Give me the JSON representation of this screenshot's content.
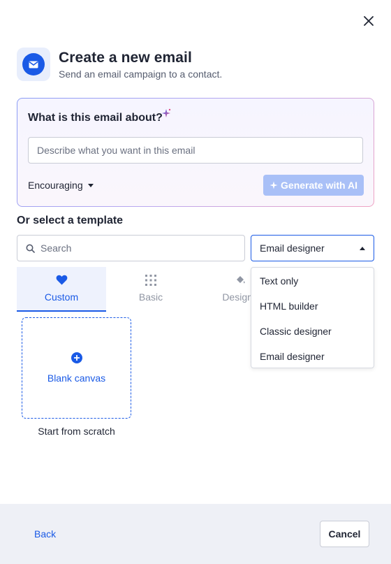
{
  "dialog": {
    "title": "Create a new email",
    "subtitle": "Send an email campaign to a contact.",
    "icons": {
      "close": "close-icon",
      "header": "envelope-icon"
    }
  },
  "ai": {
    "question": "What is this email about?",
    "input_placeholder": "Describe what you want in this email",
    "input_value": "",
    "tone": "Encouraging",
    "generate_label": "Generate with AI"
  },
  "templates": {
    "heading": "Or select a template",
    "search_placeholder": "Search",
    "selected_type": "Email designer",
    "type_options": [
      "Text only",
      "HTML builder",
      "Classic designer",
      "Email designer"
    ],
    "tabs": [
      {
        "label": "Custom",
        "icon": "heart-icon",
        "active": true
      },
      {
        "label": "Basic",
        "icon": "grid-icon",
        "active": false
      },
      {
        "label": "Designe",
        "icon": "paint-bucket-icon",
        "active": false
      }
    ],
    "blank_canvas": {
      "label": "Blank canvas",
      "caption": "Start from scratch"
    }
  },
  "footer": {
    "back_label": "Back",
    "cancel_label": "Cancel"
  },
  "colors": {
    "accent": "#1a5ae6",
    "accent_light_bg": "#eef2fd",
    "generate_disabled": "#a9c0f7",
    "footer_bg": "#eef0f6"
  }
}
